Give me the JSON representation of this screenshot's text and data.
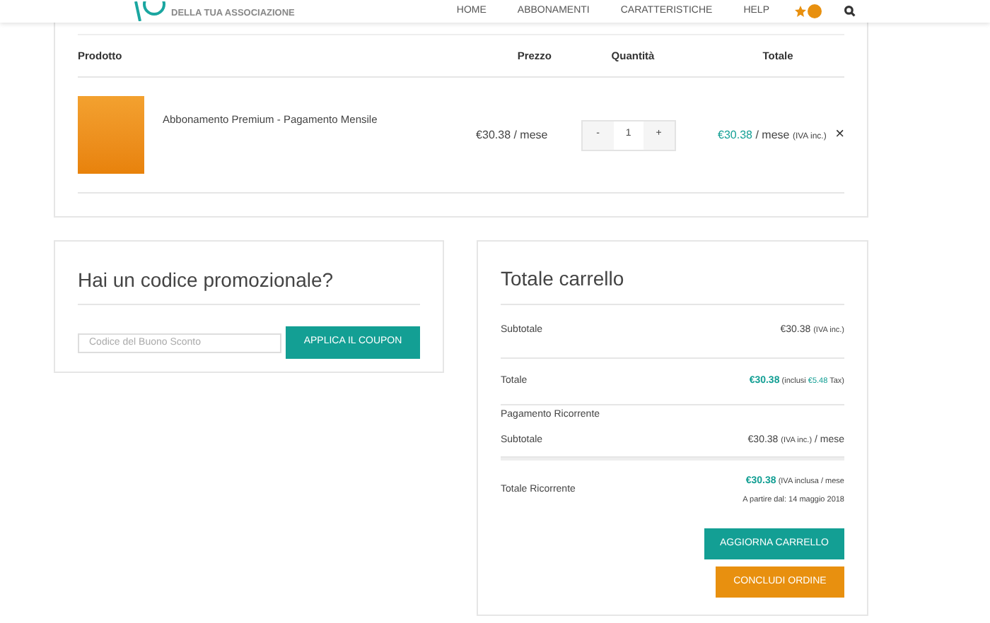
{
  "header": {
    "tagline": "DELLA TUA ASSOCIAZIONE",
    "nav": [
      "HOME",
      "ABBONAMENTI",
      "CARATTERISTICHE",
      "HELP"
    ]
  },
  "cart": {
    "columns": [
      "Prodotto",
      "Prezzo",
      "Quantità",
      "Totale"
    ],
    "items": [
      {
        "name": "Abbonamento Premium - Pagamento Mensile",
        "price": "€30.38 / mese",
        "quantity": "1",
        "minus": "-",
        "plus": "+",
        "total_amount": "€30.38",
        "total_suffix": "/ mese",
        "total_note": "(IVA inc.)",
        "remove": "×"
      }
    ]
  },
  "coupon": {
    "title": "Hai un codice promozionale?",
    "placeholder": "Codice del Buono Sconto",
    "button": "APPLICA IL COUPON"
  },
  "totals": {
    "title": "Totale carrello",
    "rows": [
      {
        "kind": "plain",
        "label": "Subtotale",
        "amount": "€30.38",
        "note": "(IVA inc.)"
      },
      {
        "kind": "total",
        "label": "Totale",
        "amount": "€30.38",
        "note_before": "(inclusi",
        "tax": "€5.48",
        "note_after": "Tax)"
      },
      {
        "kind": "heading",
        "label": "Pagamento Ricorrente"
      },
      {
        "kind": "plain",
        "label": "Subtotale",
        "amount": "€30.38",
        "note": "(IVA inc.)",
        "suffix": "/ mese"
      },
      {
        "kind": "recurring",
        "label": "Totale Ricorrente",
        "amount": "€30.38",
        "note": "(IVA inclusa / mese",
        "date": "A partire dal: 14 maggio 2018"
      }
    ],
    "buttons": [
      {
        "kind": "update",
        "label": "AGGIORNA CARRELLO"
      },
      {
        "kind": "checkout",
        "label": "CONCLUDI ORDINE"
      }
    ]
  }
}
